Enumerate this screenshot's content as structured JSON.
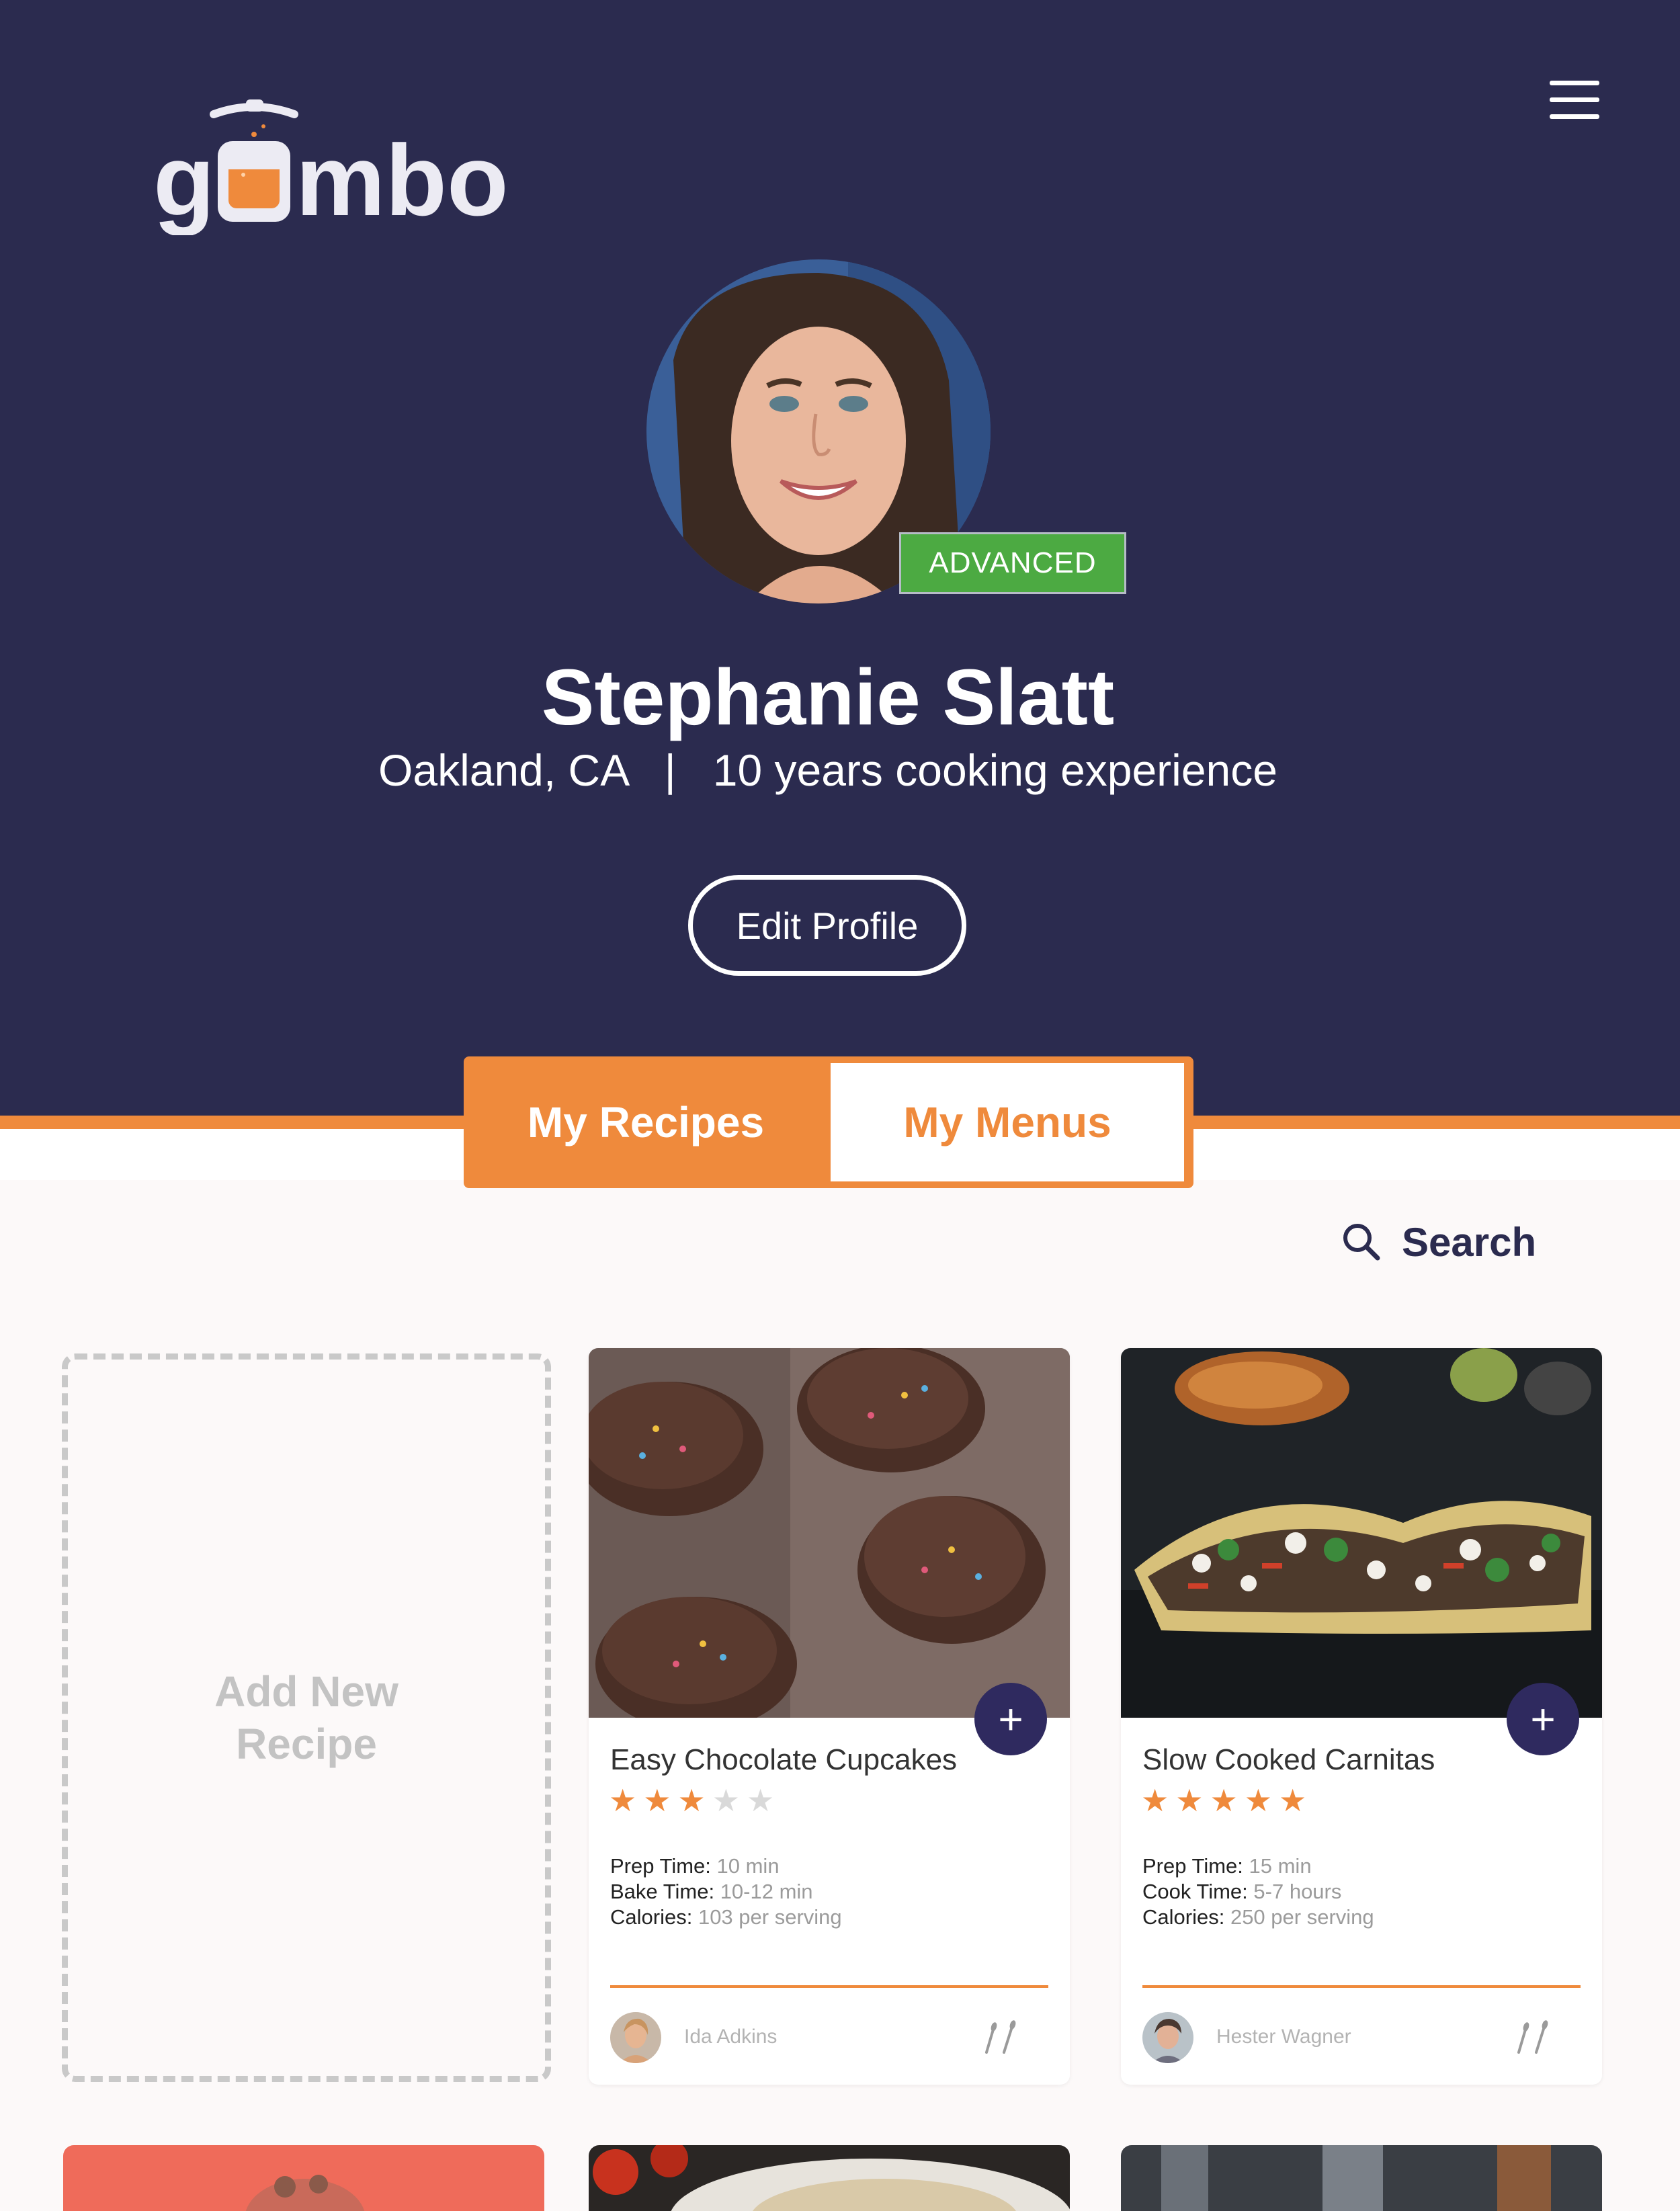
{
  "app": {
    "brand": "gumbo",
    "accent_color": "#ef8a3c",
    "primary_color": "#2b2b4f"
  },
  "header": {
    "menu_icon": "hamburger-menu-icon"
  },
  "profile": {
    "name": "Stephanie Slatt",
    "location": "Oakland, CA",
    "separator": "|",
    "experience": "10 years cooking experience",
    "level_badge": "ADVANCED",
    "edit_label": "Edit Profile"
  },
  "tabs": [
    {
      "label": "My Recipes",
      "active": true
    },
    {
      "label": "My Menus",
      "active": false
    }
  ],
  "search": {
    "label": "Search",
    "icon": "search-icon"
  },
  "add_card": {
    "label": "Add New Recipe"
  },
  "recipes": [
    {
      "title": "Easy Chocolate Cupcakes",
      "rating": 3,
      "max_rating": 5,
      "details": [
        {
          "label": "Prep Time:",
          "value": "10 min"
        },
        {
          "label": "Bake Time:",
          "value": "10-12 min"
        },
        {
          "label": "Calories:",
          "value": "103 per serving"
        }
      ],
      "author": "Ida Adkins",
      "add_icon": "+"
    },
    {
      "title": "Slow Cooked Carnitas",
      "rating": 5,
      "max_rating": 5,
      "details": [
        {
          "label": "Prep Time:",
          "value": "15 min"
        },
        {
          "label": "Cook Time:",
          "value": "5-7 hours"
        },
        {
          "label": "Calories:",
          "value": "250 per serving"
        }
      ],
      "author": "Hester Wagner",
      "add_icon": "+"
    }
  ]
}
